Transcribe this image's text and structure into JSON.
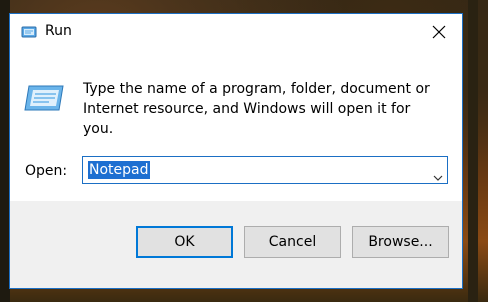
{
  "window": {
    "title": "Run",
    "accent_color": "#1b6fc4"
  },
  "dialog": {
    "description": "Type the name of a program, folder, document or Internet resource, and Windows will open it for you.",
    "open_label": "Open:",
    "open_value": "Notepad",
    "selection_color": "#1d6fd1"
  },
  "buttons": {
    "ok_label": "OK",
    "cancel_label": "Cancel",
    "browse_label": "Browse..."
  },
  "icons": {
    "title_icon": "run-app-icon",
    "close_icon": "close-icon",
    "dialog_icon": "run-program-icon",
    "dropdown_icon": "chevron-down-icon"
  }
}
